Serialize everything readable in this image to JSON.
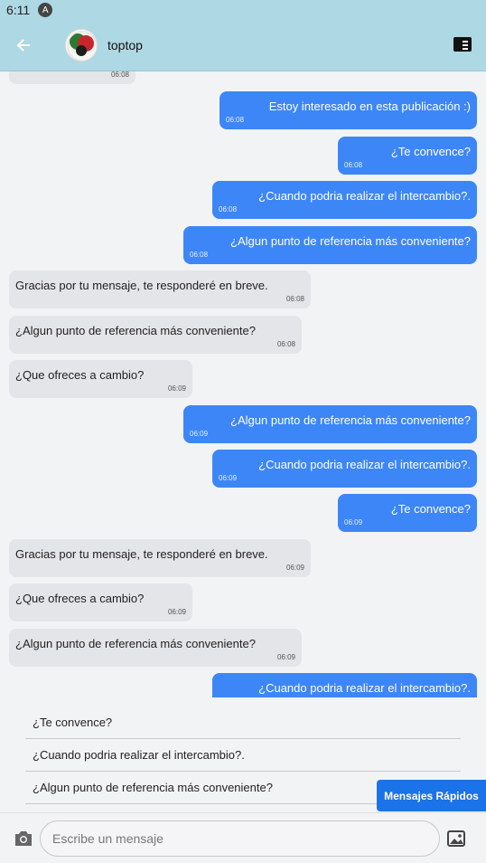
{
  "status_bar": {
    "time": "6:11",
    "indicator": "A"
  },
  "header": {
    "back_icon": "arrow-left-icon",
    "contact_name": "toptop",
    "action_icon": "notes-icon"
  },
  "messages": [
    {
      "dir": "in",
      "text": "",
      "time": "06:08"
    },
    {
      "dir": "out",
      "text": "Estoy interesado en esta publicación :)",
      "time": "06:08"
    },
    {
      "dir": "out",
      "text": "¿Te convence?",
      "time": "06:08"
    },
    {
      "dir": "out",
      "text": "¿Cuando podria realizar el intercambio?.",
      "time": "06:08"
    },
    {
      "dir": "out",
      "text": "¿Algun punto de referencia más conveniente?",
      "time": "06:08"
    },
    {
      "dir": "in",
      "text": "Gracias por tu mensaje, te responderé en breve.",
      "time": "06:08"
    },
    {
      "dir": "in",
      "text": "¿Algun punto de referencia más conveniente?",
      "time": "06:08"
    },
    {
      "dir": "in",
      "text": "¿Que ofreces a cambio?",
      "time": "06:09"
    },
    {
      "dir": "out",
      "text": "¿Algun punto de referencia más conveniente?",
      "time": "06:09"
    },
    {
      "dir": "out",
      "text": "¿Cuando podria realizar el intercambio?.",
      "time": "06:09"
    },
    {
      "dir": "out",
      "text": "¿Te convence?",
      "time": "06:09"
    },
    {
      "dir": "in",
      "text": "Gracias por tu mensaje, te responderé en breve.",
      "time": "06:09"
    },
    {
      "dir": "in",
      "text": "¿Que ofreces a cambio?",
      "time": "06:09"
    },
    {
      "dir": "in",
      "text": "¿Algun punto de referencia más conveniente?",
      "time": "06:09"
    },
    {
      "dir": "out",
      "text": "¿Cuando podria realizar el intercambio?.",
      "time": ""
    }
  ],
  "quick_replies": {
    "items": [
      "¿Te convence?",
      "¿Cuando podria realizar el intercambio?.",
      "¿Algun punto de referencia más conveniente?"
    ],
    "button_label": "Mensajes Rápidos"
  },
  "composer": {
    "placeholder": "Escribe un mensaje",
    "camera_icon": "camera-icon",
    "gallery_icon": "gallery-icon"
  },
  "colors": {
    "header_bg": "#aed8e3",
    "outgoing_bubble": "#3d86f7",
    "incoming_bubble": "#e4e5e8",
    "quick_button": "#1a73e8"
  }
}
